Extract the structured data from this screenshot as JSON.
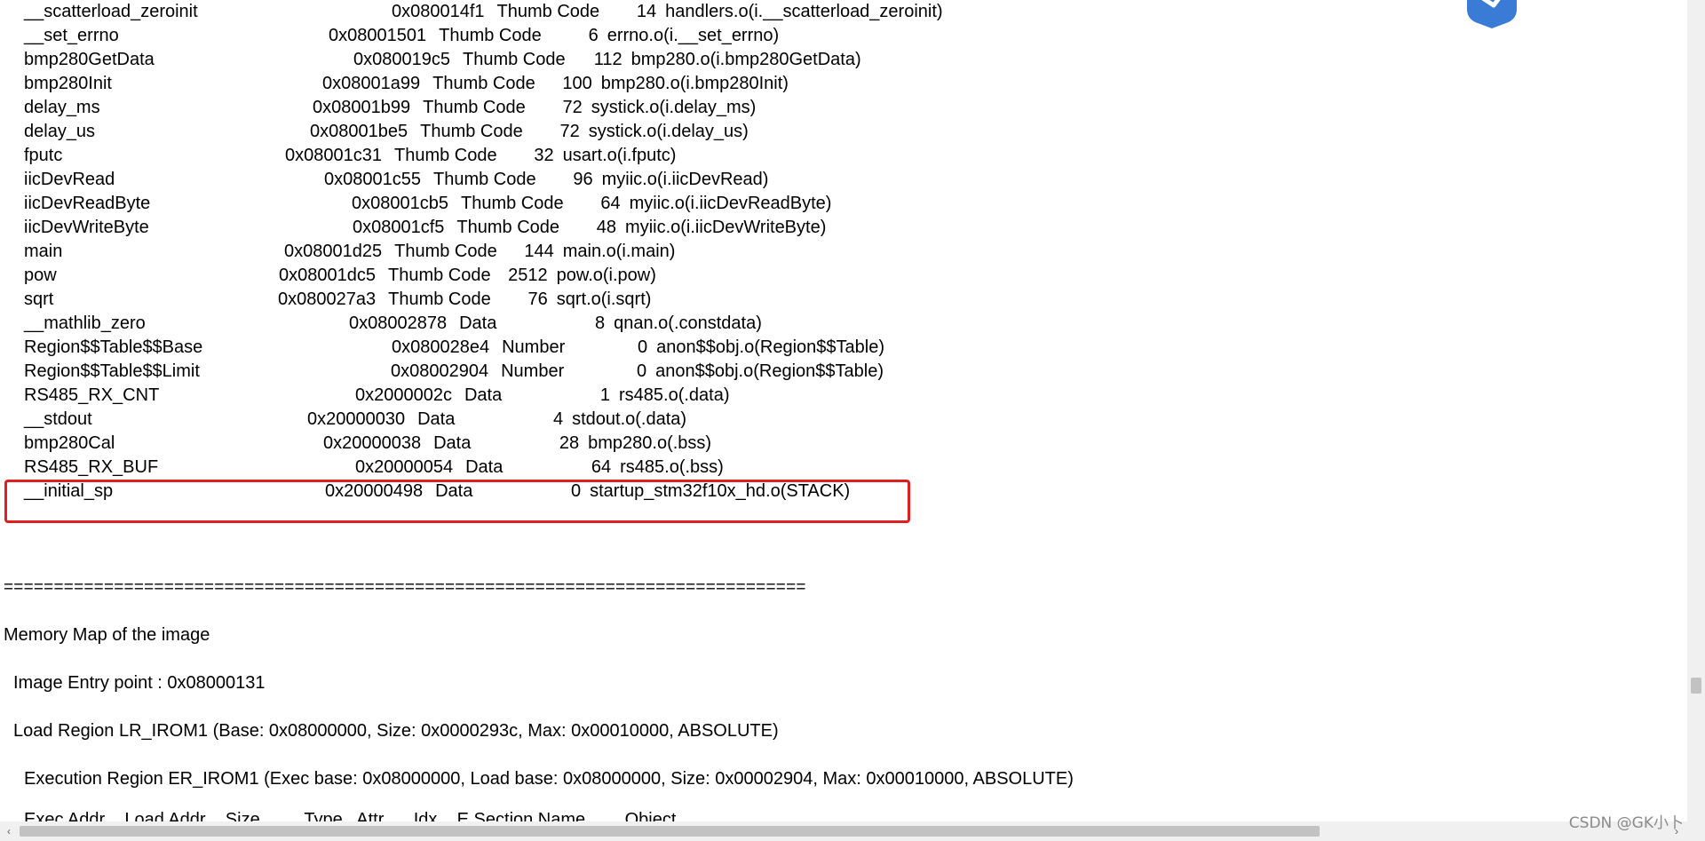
{
  "symbols": [
    {
      "name": "__scatterload_zeroinit",
      "addr": "0x080014f1",
      "type": "Thumb Code",
      "size": "14",
      "obj": "handlers.o(i.__scatterload_zeroinit)"
    },
    {
      "name": "__set_errno",
      "addr": "0x08001501",
      "type": "Thumb Code",
      "size": "6",
      "obj": "errno.o(i.__set_errno)"
    },
    {
      "name": "bmp280GetData",
      "addr": "0x080019c5",
      "type": "Thumb Code",
      "size": "112",
      "obj": "bmp280.o(i.bmp280GetData)"
    },
    {
      "name": "bmp280Init",
      "addr": "0x08001a99",
      "type": "Thumb Code",
      "size": "100",
      "obj": "bmp280.o(i.bmp280Init)"
    },
    {
      "name": "delay_ms",
      "addr": "0x08001b99",
      "type": "Thumb Code",
      "size": "72",
      "obj": "systick.o(i.delay_ms)"
    },
    {
      "name": "delay_us",
      "addr": "0x08001be5",
      "type": "Thumb Code",
      "size": "72",
      "obj": "systick.o(i.delay_us)"
    },
    {
      "name": "fputc",
      "addr": "0x08001c31",
      "type": "Thumb Code",
      "size": "32",
      "obj": "usart.o(i.fputc)"
    },
    {
      "name": "iicDevRead",
      "addr": "0x08001c55",
      "type": "Thumb Code",
      "size": "96",
      "obj": "myiic.o(i.iicDevRead)"
    },
    {
      "name": "iicDevReadByte",
      "addr": "0x08001cb5",
      "type": "Thumb Code",
      "size": "64",
      "obj": "myiic.o(i.iicDevReadByte)"
    },
    {
      "name": "iicDevWriteByte",
      "addr": "0x08001cf5",
      "type": "Thumb Code",
      "size": "48",
      "obj": "myiic.o(i.iicDevWriteByte)"
    },
    {
      "name": "main",
      "addr": "0x08001d25",
      "type": "Thumb Code",
      "size": "144",
      "obj": "main.o(i.main)"
    },
    {
      "name": "pow",
      "addr": "0x08001dc5",
      "type": "Thumb Code",
      "size": "2512",
      "obj": "pow.o(i.pow)"
    },
    {
      "name": "sqrt",
      "addr": "0x080027a3",
      "type": "Thumb Code",
      "size": "76",
      "obj": "sqrt.o(i.sqrt)"
    },
    {
      "name": "__mathlib_zero",
      "addr": "0x08002878",
      "type": "Data",
      "size": "8",
      "obj": "qnan.o(.constdata)"
    },
    {
      "name": "Region$$Table$$Base",
      "addr": "0x080028e4",
      "type": "Number",
      "size": "0",
      "obj": "anon$$obj.o(Region$$Table)"
    },
    {
      "name": "Region$$Table$$Limit",
      "addr": "0x08002904",
      "type": "Number",
      "size": "0",
      "obj": "anon$$obj.o(Region$$Table)"
    },
    {
      "name": "RS485_RX_CNT",
      "addr": "0x2000002c",
      "type": "Data",
      "size": "1",
      "obj": "rs485.o(.data)"
    },
    {
      "name": "__stdout",
      "addr": "0x20000030",
      "type": "Data",
      "size": "4",
      "obj": "stdout.o(.data)"
    },
    {
      "name": "bmp280Cal",
      "addr": "0x20000038",
      "type": "Data",
      "size": "28",
      "obj": "bmp280.o(.bss)"
    },
    {
      "name": "RS485_RX_BUF",
      "addr": "0x20000054",
      "type": "Data",
      "size": "64",
      "obj": "rs485.o(.bss)"
    },
    {
      "name": "__initial_sp",
      "addr": "0x20000498",
      "type": "Data",
      "size": "0",
      "obj": "startup_stm32f10x_hd.o(STACK)"
    }
  ],
  "separator": "================================================================================",
  "memory_map_title": "Memory Map of the image",
  "entry_point": "Image Entry point : 0x08000131",
  "load_region": "Load Region LR_IROM1 (Base: 0x08000000, Size: 0x0000293c, Max: 0x00010000, ABSOLUTE)",
  "exec_region": "Execution Region ER_IROM1 (Exec base: 0x08000000, Load base: 0x08000000, Size: 0x00002904, Max: 0x00010000, ABSOLUTE)",
  "column_header_partial": "Exec Addr    Load Addr    Size         Type   Attr      Idx    E Section Name        Object",
  "scroll": {
    "left_arrow": "‹",
    "right_arrow": "›"
  },
  "watermark": "CSDN @GK小卜",
  "badge_color": "#3a7bd5",
  "highlight_color": "#e02020"
}
